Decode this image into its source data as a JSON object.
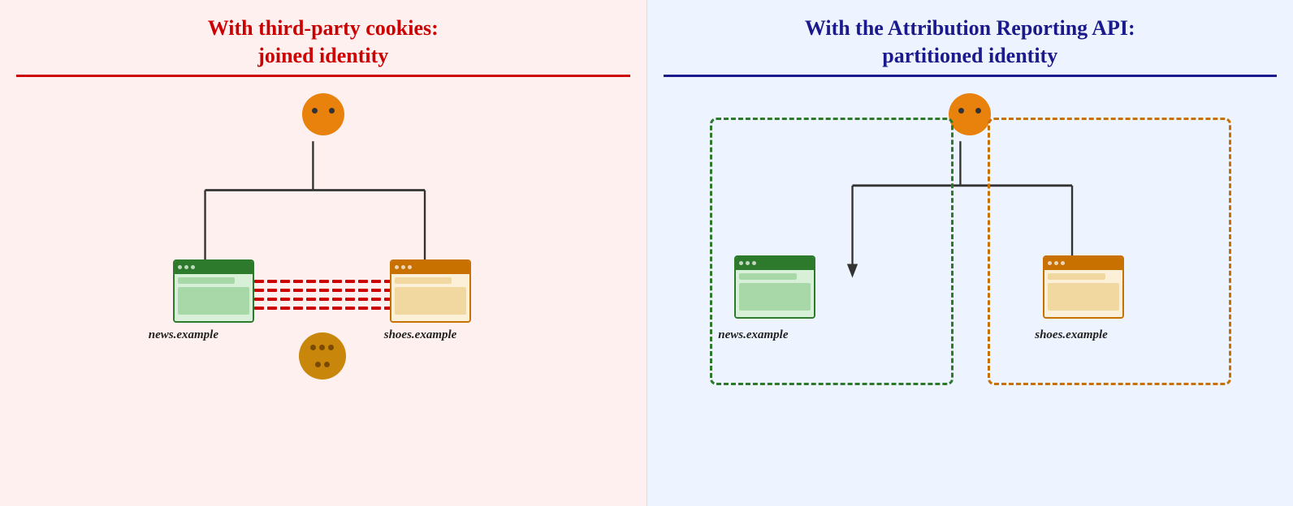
{
  "left": {
    "title_line1": "With third-party cookies:",
    "title_line2": "joined identity",
    "site1_label": "news.example",
    "site2_label": "shoes.example"
  },
  "right": {
    "title_line1": "With the Attribution Reporting API:",
    "title_line2": "partitioned identity",
    "site1_label": "news.example",
    "site2_label": "shoes.example"
  }
}
